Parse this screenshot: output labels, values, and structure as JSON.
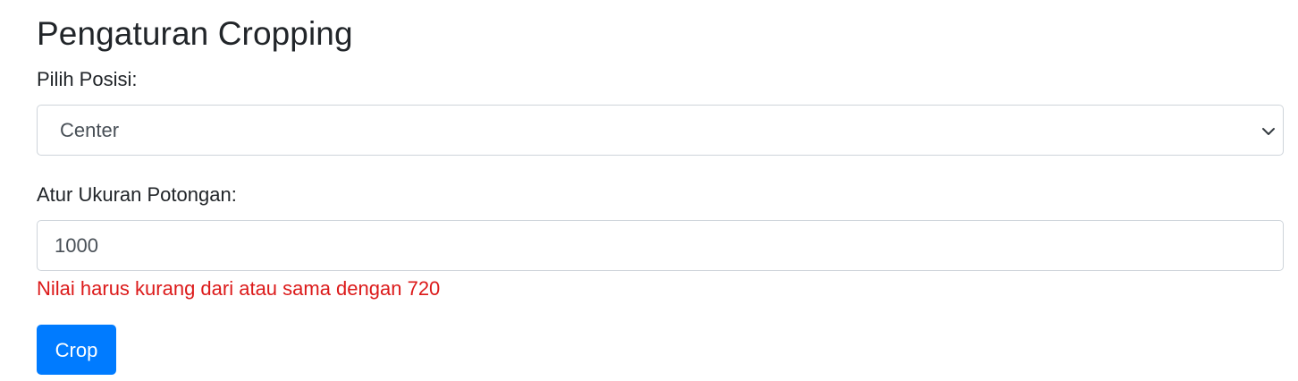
{
  "page": {
    "title": "Pengaturan Cropping"
  },
  "position_field": {
    "label": "Pilih Posisi:",
    "selected": "Center",
    "icon": "chevron-down-icon"
  },
  "size_field": {
    "label": "Atur Ukuran Potongan:",
    "value": "1000",
    "error": "Nilai harus kurang dari atau sama dengan 720"
  },
  "actions": {
    "crop_label": "Crop"
  },
  "colors": {
    "primary": "#007bff",
    "error": "#dc1a1a",
    "border": "#ced4da",
    "text": "#212529"
  }
}
